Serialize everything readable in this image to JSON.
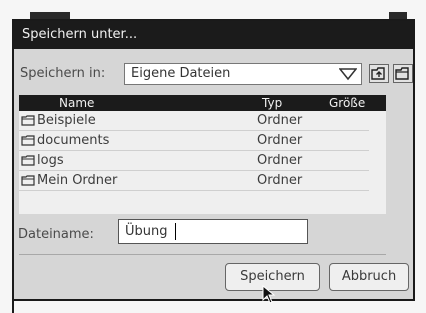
{
  "dialog": {
    "title": "Speichern unter..."
  },
  "save_in": {
    "label": "Speichern in:",
    "value": "Eigene Dateien"
  },
  "icons": {
    "combo_arrow": "chevron-down-icon",
    "up_folder": "folder-up-icon",
    "new_folder": "new-folder-icon",
    "row_folder": "folder-icon",
    "scroll_up": "scroll-up-arrow-icon",
    "scroll_down": "scroll-down-arrow-icon",
    "cursor": "mouse-pointer-icon"
  },
  "file_list": {
    "columns": [
      "Name",
      "Typ",
      "Größe"
    ],
    "rows": [
      {
        "name": "Beispiele",
        "type": "Ordner"
      },
      {
        "name": "documents",
        "type": "Ordner"
      },
      {
        "name": "logs",
        "type": "Ordner"
      },
      {
        "name": "Mein Ordner",
        "type": "Ordner"
      }
    ]
  },
  "filename": {
    "label": "Dateiname:",
    "value": "Übung"
  },
  "buttons": {
    "save": "Speichern",
    "cancel": "Abbruch"
  },
  "colors": {
    "title_bg": "#1b1b1b",
    "dialog_bg": "#d6d6d6",
    "list_bg": "#efefef"
  }
}
